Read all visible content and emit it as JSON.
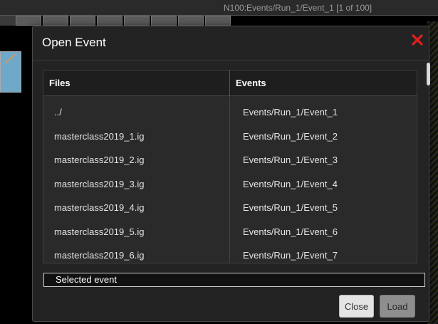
{
  "background": {
    "window_title": "N100:Events/Run_1/Event_1 [1 of 100]"
  },
  "dialog": {
    "title": "Open Event",
    "close_icon_color": "#e02020",
    "columns": {
      "files": "Files",
      "events": "Events"
    },
    "files": [
      "../",
      "masterclass2019_1.ig",
      "masterclass2019_2.ig",
      "masterclass2019_3.ig",
      "masterclass2019_4.ig",
      "masterclass2019_5.ig",
      "masterclass2019_6.ig"
    ],
    "events": [
      "Events/Run_1/Event_1",
      "Events/Run_1/Event_2",
      "Events/Run_1/Event_3",
      "Events/Run_1/Event_4",
      "Events/Run_1/Event_5",
      "Events/Run_1/Event_6",
      "Events/Run_1/Event_7"
    ],
    "selected_event": "Selected event",
    "buttons": {
      "close": "Close",
      "load": "Load"
    }
  }
}
